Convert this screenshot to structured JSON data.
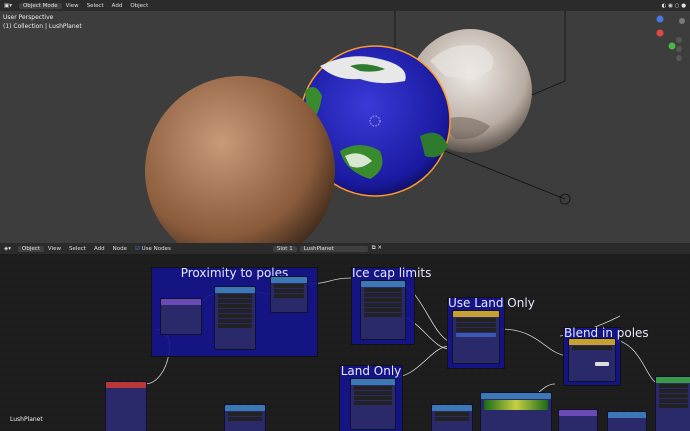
{
  "viewport_header": {
    "mode": "Object Mode",
    "menus": [
      "View",
      "Select",
      "Add",
      "Object"
    ]
  },
  "viewport_overlay": {
    "view_name": "User Perspective",
    "collection": "(1) Collection | LushPlanet"
  },
  "node_header": {
    "object_type": "Object",
    "menus": [
      "View",
      "Select",
      "Add",
      "Node"
    ],
    "use_nodes_label": "Use Nodes",
    "slot": "Slot 1",
    "material": "LushPlanet"
  },
  "node_editor": {
    "frames": [
      "Proximity to poles",
      "Ice cap limits",
      "Use Land Only",
      "Blend in poles",
      "Land Only"
    ],
    "material_label": "LushPlanet"
  },
  "colors": {
    "viewport_bg": "#3d3d3d",
    "header_bg": "#2b2b2b",
    "frame_bg": "#14148c",
    "wire": "#d0d0d0",
    "selection_outline": "#ff9a2a"
  }
}
